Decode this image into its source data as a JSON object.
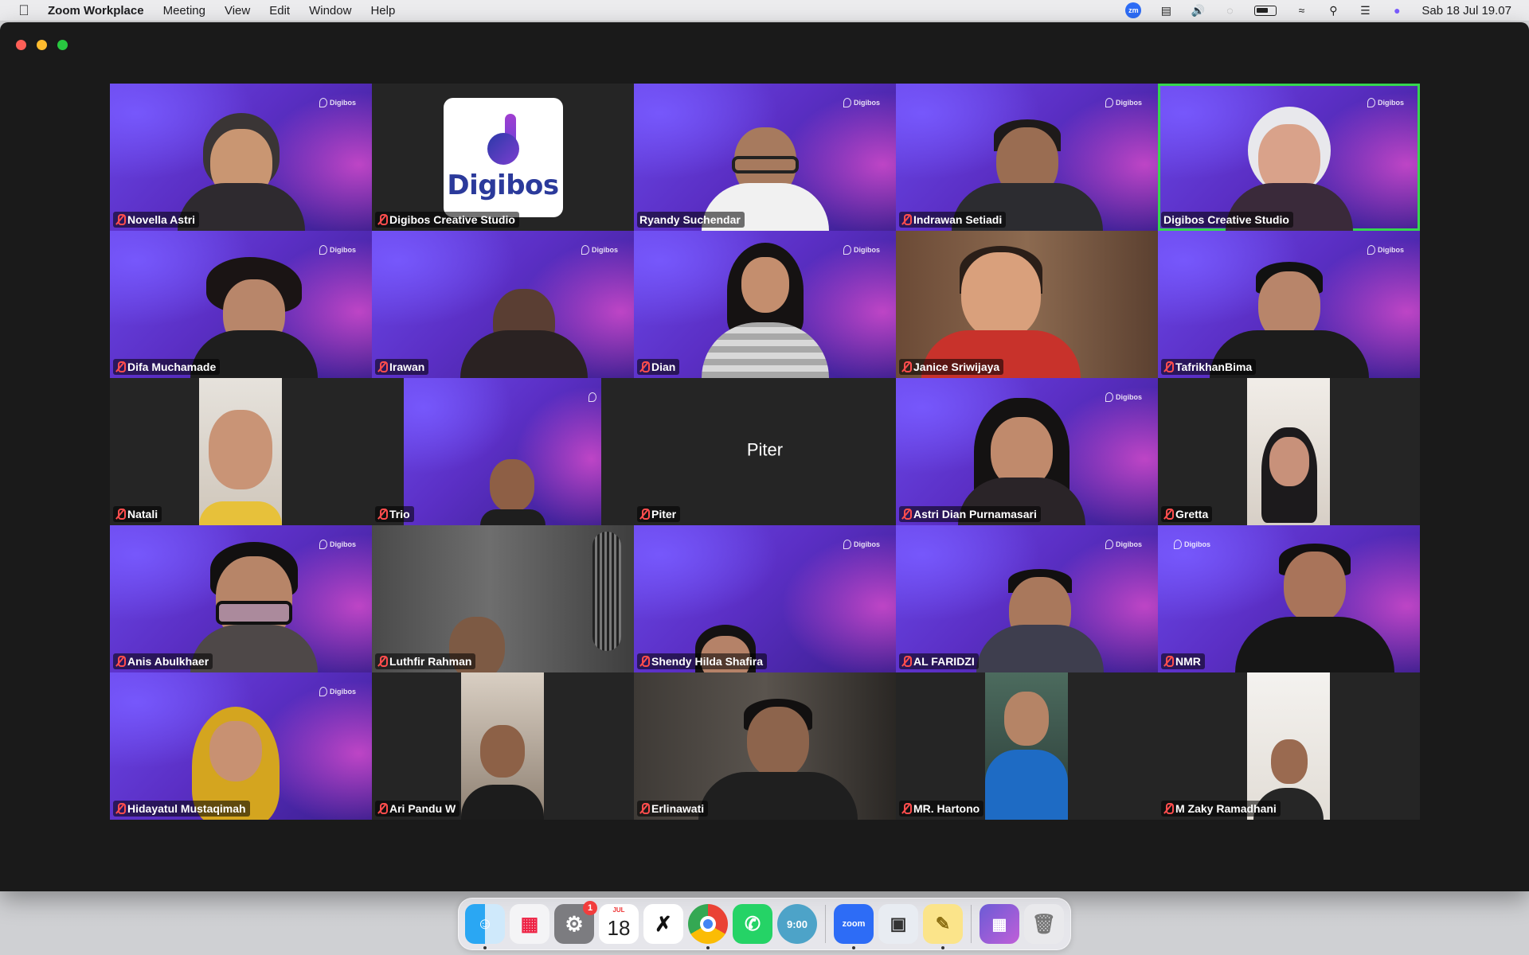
{
  "menubar": {
    "app_name": "Zoom Workplace",
    "menus": [
      "Meeting",
      "View",
      "Edit",
      "Window",
      "Help"
    ],
    "clock": "Sab 18 Jul  19.07",
    "zoom_badge": "zm"
  },
  "tile_main": {
    "logo_text": "Digibos"
  },
  "participants": [
    {
      "name": "Novella Astri",
      "muted": true
    },
    {
      "name": "Digibos Creative Studio",
      "muted": true
    },
    {
      "name": "Ryandy Suchendar",
      "muted": false
    },
    {
      "name": "Indrawan Setiadi",
      "muted": true
    },
    {
      "name": "Digibos Creative Studio",
      "muted": false,
      "active_speaker": true
    },
    {
      "name": "Difa Muchamade",
      "muted": true
    },
    {
      "name": "Irawan",
      "muted": true
    },
    {
      "name": "Dian",
      "muted": true
    },
    {
      "name": "Janice Sriwijaya",
      "muted": true
    },
    {
      "name": "TafrikhanBima",
      "muted": true
    },
    {
      "name": "Natali",
      "muted": true
    },
    {
      "name": "Trio",
      "muted": true
    },
    {
      "name": "Piter",
      "muted": true,
      "video_off": true
    },
    {
      "name": "Astri Dian Purnamasari",
      "muted": true
    },
    {
      "name": "Gretta",
      "muted": true
    },
    {
      "name": "Anis Abulkhaer",
      "muted": true
    },
    {
      "name": "Luthfir Rahman",
      "muted": true
    },
    {
      "name": "Shendy Hilda Shafira",
      "muted": true
    },
    {
      "name": "AL FARIDZI",
      "muted": true
    },
    {
      "name": "NMR",
      "muted": true
    },
    {
      "name": "Hidayatul Mustaqimah",
      "muted": true
    },
    {
      "name": "Ari Pandu W",
      "muted": true
    },
    {
      "name": "Erlinawati",
      "muted": true
    },
    {
      "name": "MR. Hartono",
      "muted": true
    },
    {
      "name": "M Zaky Ramadhani",
      "muted": true
    }
  ],
  "piter_label": "Piter",
  "brand_watermark": "Digibos",
  "dock": {
    "badge_settings": "1",
    "calendar_month": "JUL",
    "calendar_day": "18",
    "clock_app": "9:00",
    "zoom_label": "zoom"
  }
}
